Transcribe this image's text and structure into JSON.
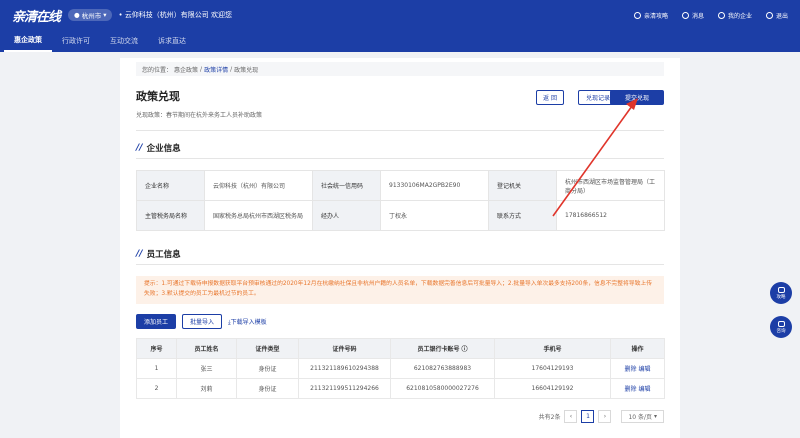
{
  "header": {
    "logo": "亲清在线",
    "city": "杭州市",
    "company": "云仰科技（杭州）有限公司 欢迎您",
    "actions": [
      {
        "label": "亲清攻略",
        "icon": "guide-icon"
      },
      {
        "label": "消息",
        "icon": "bell-icon"
      },
      {
        "label": "我的企业",
        "icon": "building-icon"
      },
      {
        "label": "退出",
        "icon": "power-icon"
      }
    ]
  },
  "nav": {
    "tabs": [
      "惠企政策",
      "行政许可",
      "互动交流",
      "诉求直达"
    ],
    "active": 0
  },
  "breadcrumb": {
    "prefix": "您的位置：",
    "items": [
      "惠企政策",
      "政策详情",
      "政策兑现"
    ],
    "sep": "/"
  },
  "page": {
    "title": "政策兑现",
    "subtitle": "兑现政策：春节期间在杭外来务工人员补助政策",
    "buttons": {
      "back": "返 回",
      "records": "兑现记录",
      "submit": "提交兑现"
    }
  },
  "enterprise": {
    "title": "企业信息",
    "rows": [
      [
        {
          "label": "企业名称",
          "value": "云仰科技（杭州）有限公司"
        },
        {
          "label": "社会统一信用码",
          "value": "91330106MA2GPB2E90"
        },
        {
          "label": "登记机关",
          "value": "杭州市西湖区市场监督管理局（工商分局）"
        }
      ],
      [
        {
          "label": "主管税务局名称",
          "value": "国家税务总局杭州市西湖区税务局"
        },
        {
          "label": "经办人",
          "value": "丁权永"
        },
        {
          "label": "联系方式",
          "value": "17816866512"
        }
      ]
    ]
  },
  "employees": {
    "title": "员工信息",
    "notice": "提示：1.可通过下载待申报数据获取平台预审核通过的2020年12月在杭缴纳社保且非杭州户籍的人员名单，下载数据完善信息后可批量导入；2.批量导入单次最多支持200条，信息不完整将导致上传失败；3.默认提交的员工为最机过节的员工。",
    "buttons": {
      "add": "添加员工",
      "import": "批量导入",
      "template": "下载导入模板"
    },
    "columns": [
      "序号",
      "员工姓名",
      "证件类型",
      "证件号码",
      "员工银行卡账号",
      "手机号",
      "操作"
    ],
    "rows": [
      {
        "no": "1",
        "name": "张三",
        "idtype": "身份证",
        "id": "211321189610294388",
        "card": "621082763888983",
        "phone": "17604129193"
      },
      {
        "no": "2",
        "name": "刘莉",
        "idtype": "身份证",
        "id": "211321199511294266",
        "card": "6210810580000027276",
        "phone": "16604129192"
      }
    ],
    "op_delete": "删除",
    "op_edit": "编辑"
  },
  "pager": {
    "total": "共有2条",
    "current": "1",
    "size": "10 条/页"
  },
  "float": [
    {
      "label": "攻略",
      "icon": "guide-icon"
    },
    {
      "label": "咨询",
      "icon": "headset-icon"
    }
  ],
  "colors": {
    "brand": "#1c3ea6",
    "notice_text": "#e8762d",
    "notice_bg": "#fdf1e8",
    "annotation": "#e0352b"
  }
}
